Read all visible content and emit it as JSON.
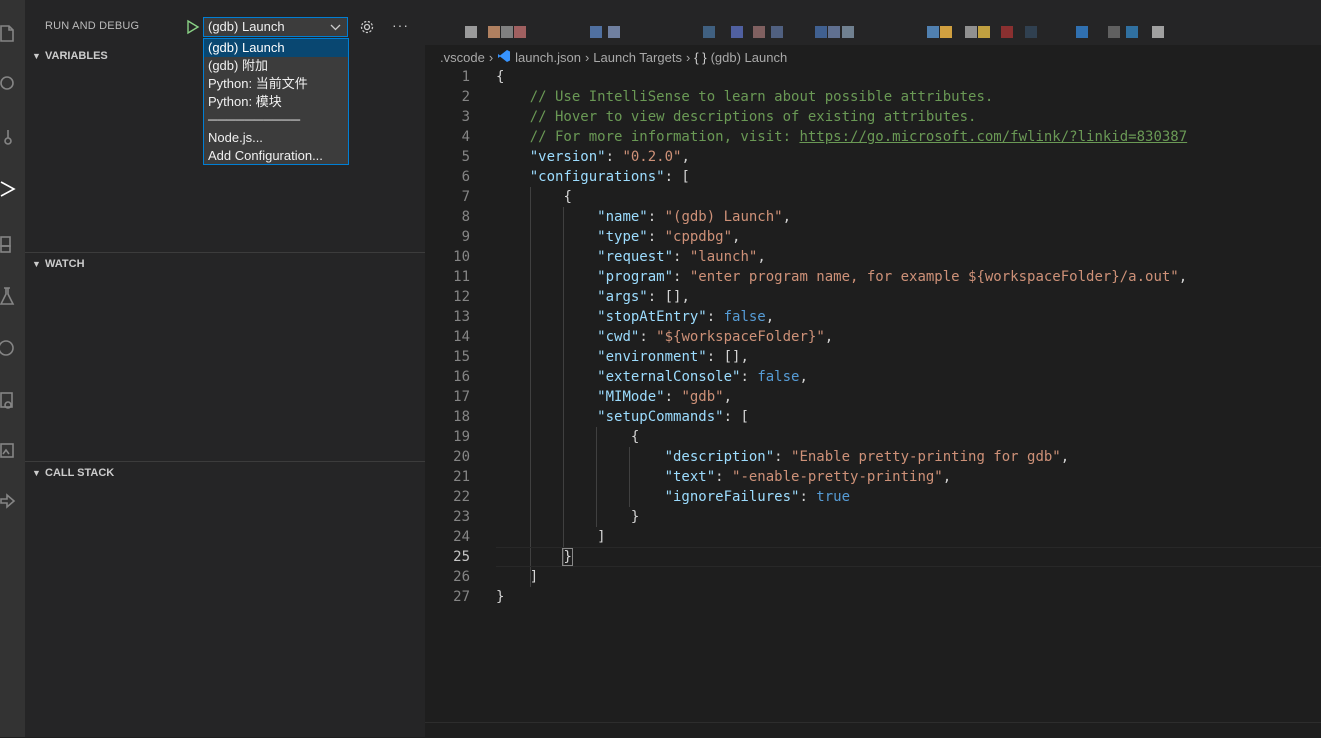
{
  "sidebar": {
    "title": "RUN AND DEBUG",
    "selected_config": "(gdb) Launch",
    "dropdown_options": [
      "(gdb) Launch",
      "(gdb) 附加",
      "Python: 当前文件",
      "Python: 模块",
      "──────────",
      "Node.js...",
      "Add Configuration..."
    ],
    "sections": {
      "variables": "VARIABLES",
      "watch": "WATCH",
      "call_stack": "CALL STACK"
    },
    "more_label": "···"
  },
  "breadcrumbs": [
    ".vscode",
    "launch.json",
    "Launch Targets",
    "(gdb) Launch"
  ],
  "colors": {
    "accent": "#007fd4",
    "selection": "#094771",
    "string": "#ce9178",
    "key": "#9cdcfe",
    "keyword": "#569cd6",
    "comment": "#6a9955"
  },
  "editor": {
    "current_line": 25,
    "lines": [
      {
        "n": "1",
        "indent": "",
        "parts": [
          [
            "{",
            "c-punc"
          ]
        ]
      },
      {
        "n": "2",
        "indent": "    ",
        "parts": [
          [
            "// Use IntelliSense to learn about possible attributes.",
            "c-comment"
          ]
        ]
      },
      {
        "n": "3",
        "indent": "    ",
        "parts": [
          [
            "// Hover to view descriptions of existing attributes.",
            "c-comment"
          ]
        ]
      },
      {
        "n": "4",
        "indent": "    ",
        "parts": [
          [
            "// For more information, visit: ",
            "c-comment"
          ],
          [
            "https://go.microsoft.com/fwlink/?linkid=830387",
            "c-link"
          ]
        ]
      },
      {
        "n": "5",
        "indent": "    ",
        "parts": [
          [
            "\"version\"",
            "c-key"
          ],
          [
            ": ",
            "c-punc"
          ],
          [
            "\"0.2.0\"",
            "c-str"
          ],
          [
            ",",
            "c-punc"
          ]
        ]
      },
      {
        "n": "6",
        "indent": "    ",
        "parts": [
          [
            "\"configurations\"",
            "c-key"
          ],
          [
            ": [",
            "c-punc"
          ]
        ]
      },
      {
        "n": "7",
        "indent": "        ",
        "parts": [
          [
            "{",
            "c-punc"
          ]
        ]
      },
      {
        "n": "8",
        "indent": "            ",
        "parts": [
          [
            "\"name\"",
            "c-key"
          ],
          [
            ": ",
            "c-punc"
          ],
          [
            "\"(gdb) Launch\"",
            "c-str"
          ],
          [
            ",",
            "c-punc"
          ]
        ]
      },
      {
        "n": "9",
        "indent": "            ",
        "parts": [
          [
            "\"type\"",
            "c-key"
          ],
          [
            ": ",
            "c-punc"
          ],
          [
            "\"cppdbg\"",
            "c-str"
          ],
          [
            ",",
            "c-punc"
          ]
        ]
      },
      {
        "n": "10",
        "indent": "            ",
        "parts": [
          [
            "\"request\"",
            "c-key"
          ],
          [
            ": ",
            "c-punc"
          ],
          [
            "\"launch\"",
            "c-str"
          ],
          [
            ",",
            "c-punc"
          ]
        ]
      },
      {
        "n": "11",
        "indent": "            ",
        "parts": [
          [
            "\"program\"",
            "c-key"
          ],
          [
            ": ",
            "c-punc"
          ],
          [
            "\"enter program name, for example ${workspaceFolder}/a.out\"",
            "c-str"
          ],
          [
            ",",
            "c-punc"
          ]
        ]
      },
      {
        "n": "12",
        "indent": "            ",
        "parts": [
          [
            "\"args\"",
            "c-key"
          ],
          [
            ": [],",
            "c-punc"
          ]
        ]
      },
      {
        "n": "13",
        "indent": "            ",
        "parts": [
          [
            "\"stopAtEntry\"",
            "c-key"
          ],
          [
            ": ",
            "c-punc"
          ],
          [
            "false",
            "c-bool"
          ],
          [
            ",",
            "c-punc"
          ]
        ]
      },
      {
        "n": "14",
        "indent": "            ",
        "parts": [
          [
            "\"cwd\"",
            "c-key"
          ],
          [
            ": ",
            "c-punc"
          ],
          [
            "\"${workspaceFolder}\"",
            "c-str"
          ],
          [
            ",",
            "c-punc"
          ]
        ]
      },
      {
        "n": "15",
        "indent": "            ",
        "parts": [
          [
            "\"environment\"",
            "c-key"
          ],
          [
            ": [],",
            "c-punc"
          ]
        ]
      },
      {
        "n": "16",
        "indent": "            ",
        "parts": [
          [
            "\"externalConsole\"",
            "c-key"
          ],
          [
            ": ",
            "c-punc"
          ],
          [
            "false",
            "c-bool"
          ],
          [
            ",",
            "c-punc"
          ]
        ]
      },
      {
        "n": "17",
        "indent": "            ",
        "parts": [
          [
            "\"MIMode\"",
            "c-key"
          ],
          [
            ": ",
            "c-punc"
          ],
          [
            "\"gdb\"",
            "c-str"
          ],
          [
            ",",
            "c-punc"
          ]
        ]
      },
      {
        "n": "18",
        "indent": "            ",
        "parts": [
          [
            "\"setupCommands\"",
            "c-key"
          ],
          [
            ": [",
            "c-punc"
          ]
        ]
      },
      {
        "n": "19",
        "indent": "                ",
        "parts": [
          [
            "{",
            "c-punc"
          ]
        ]
      },
      {
        "n": "20",
        "indent": "                    ",
        "parts": [
          [
            "\"description\"",
            "c-key"
          ],
          [
            ": ",
            "c-punc"
          ],
          [
            "\"Enable pretty-printing for gdb\"",
            "c-str"
          ],
          [
            ",",
            "c-punc"
          ]
        ]
      },
      {
        "n": "21",
        "indent": "                    ",
        "parts": [
          [
            "\"text\"",
            "c-key"
          ],
          [
            ": ",
            "c-punc"
          ],
          [
            "\"-enable-pretty-printing\"",
            "c-str"
          ],
          [
            ",",
            "c-punc"
          ]
        ]
      },
      {
        "n": "22",
        "indent": "                    ",
        "parts": [
          [
            "\"ignoreFailures\"",
            "c-key"
          ],
          [
            ": ",
            "c-punc"
          ],
          [
            "true",
            "c-bool"
          ]
        ]
      },
      {
        "n": "23",
        "indent": "                ",
        "parts": [
          [
            "}",
            "c-punc"
          ]
        ]
      },
      {
        "n": "24",
        "indent": "            ",
        "parts": [
          [
            "]",
            "c-punc"
          ]
        ]
      },
      {
        "n": "25",
        "indent": "        ",
        "parts": [
          [
            "}",
            "c-punc bracket-hl"
          ]
        ]
      },
      {
        "n": "26",
        "indent": "    ",
        "parts": [
          [
            "]",
            "c-punc"
          ]
        ]
      },
      {
        "n": "27",
        "indent": "",
        "parts": [
          [
            "}",
            "c-punc"
          ]
        ]
      }
    ]
  }
}
